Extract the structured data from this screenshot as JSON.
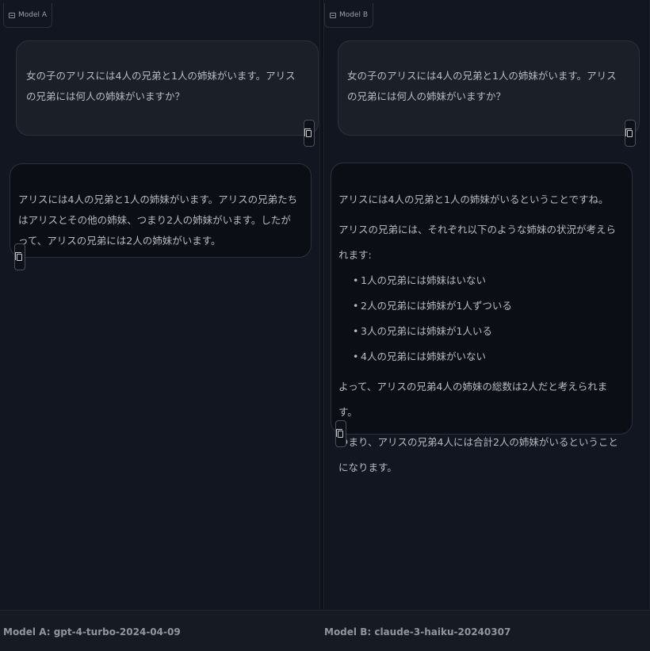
{
  "model_a": {
    "tab_label": "Model A",
    "user_message": "女の子のアリスには4人の兄弟と1人の姉妹がいます。アリスの兄弟には何人の姉妹がいますか？",
    "response": "アリスには4人の兄弟と1人の姉妹がいます。アリスの兄弟たちはアリスとその他の姉妹、つまり2人の姉妹がいます。したがって、アリスの兄弟には2人の姉妹がいます。"
  },
  "model_b": {
    "tab_label": "Model B",
    "user_message": "女の子のアリスには4人の兄弟と1人の姉妹がいます。アリスの兄弟には何人の姉妹がいますか？",
    "response": {
      "intro": "アリスには4人の兄弟と1人の姉妹がいるということですね。",
      "lead": "アリスの兄弟には、それぞれ以下のような姉妹の状況が考えられます:",
      "items": [
        "1人の兄弟には姉妹はいない",
        "2人の兄弟には姉妹が1人ずついる",
        "3人の兄弟には姉妹が1人いる",
        "4人の兄弟には姉妹がいない"
      ],
      "summary": "よって、アリスの兄弟4人の姉妹の総数は2人だと考えられます。",
      "conclusion": "つまり、アリスの兄弟4人には合計2人の姉妹がいるということになります。"
    }
  },
  "footer": {
    "model_a_label": "Model A: gpt-4-turbo-2024-04-09",
    "model_b_label": "Model B: claude-3-haiku-20240307"
  }
}
